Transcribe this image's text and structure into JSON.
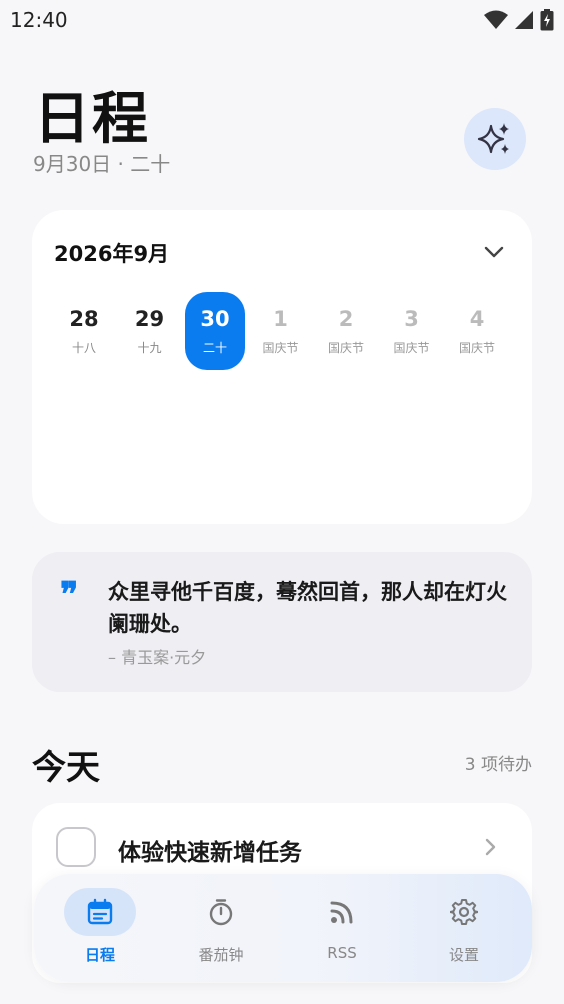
{
  "status_bar": {
    "time": "12:40"
  },
  "header": {
    "title": "日程",
    "subtitle": "9月30日 · 二十"
  },
  "calendar": {
    "month_label": "2026年9月",
    "days": [
      {
        "num": "28",
        "sub": "十八",
        "state": "normal"
      },
      {
        "num": "29",
        "sub": "十九",
        "state": "normal"
      },
      {
        "num": "30",
        "sub": "二十",
        "state": "selected"
      },
      {
        "num": "1",
        "sub": "国庆节",
        "state": "muted"
      },
      {
        "num": "2",
        "sub": "国庆节",
        "state": "muted"
      },
      {
        "num": "3",
        "sub": "国庆节",
        "state": "muted"
      },
      {
        "num": "4",
        "sub": "国庆节",
        "state": "muted"
      }
    ]
  },
  "quote": {
    "mark": "❞",
    "text": "众里寻他千百度，蓦然回首，那人却在灯火阑珊处。",
    "source": "– 青玉案·元夕"
  },
  "today": {
    "title": "今天",
    "todo_count": "3 项待办"
  },
  "tasks": [
    {
      "title": "体验快速新增任务",
      "checked": false
    }
  ],
  "nav": {
    "items": [
      {
        "label": "日程",
        "icon": "calendar-icon",
        "active": true
      },
      {
        "label": "番茄钟",
        "icon": "timer-icon",
        "active": false
      },
      {
        "label": "RSS",
        "icon": "rss-icon",
        "active": false
      },
      {
        "label": "设置",
        "icon": "gear-icon",
        "active": false
      }
    ]
  },
  "colors": {
    "accent": "#0a7cf0",
    "background": "#f7f7f9",
    "card": "#ffffff",
    "quote_bg": "#eeeef3",
    "ai_button_bg": "#dce7fb"
  }
}
